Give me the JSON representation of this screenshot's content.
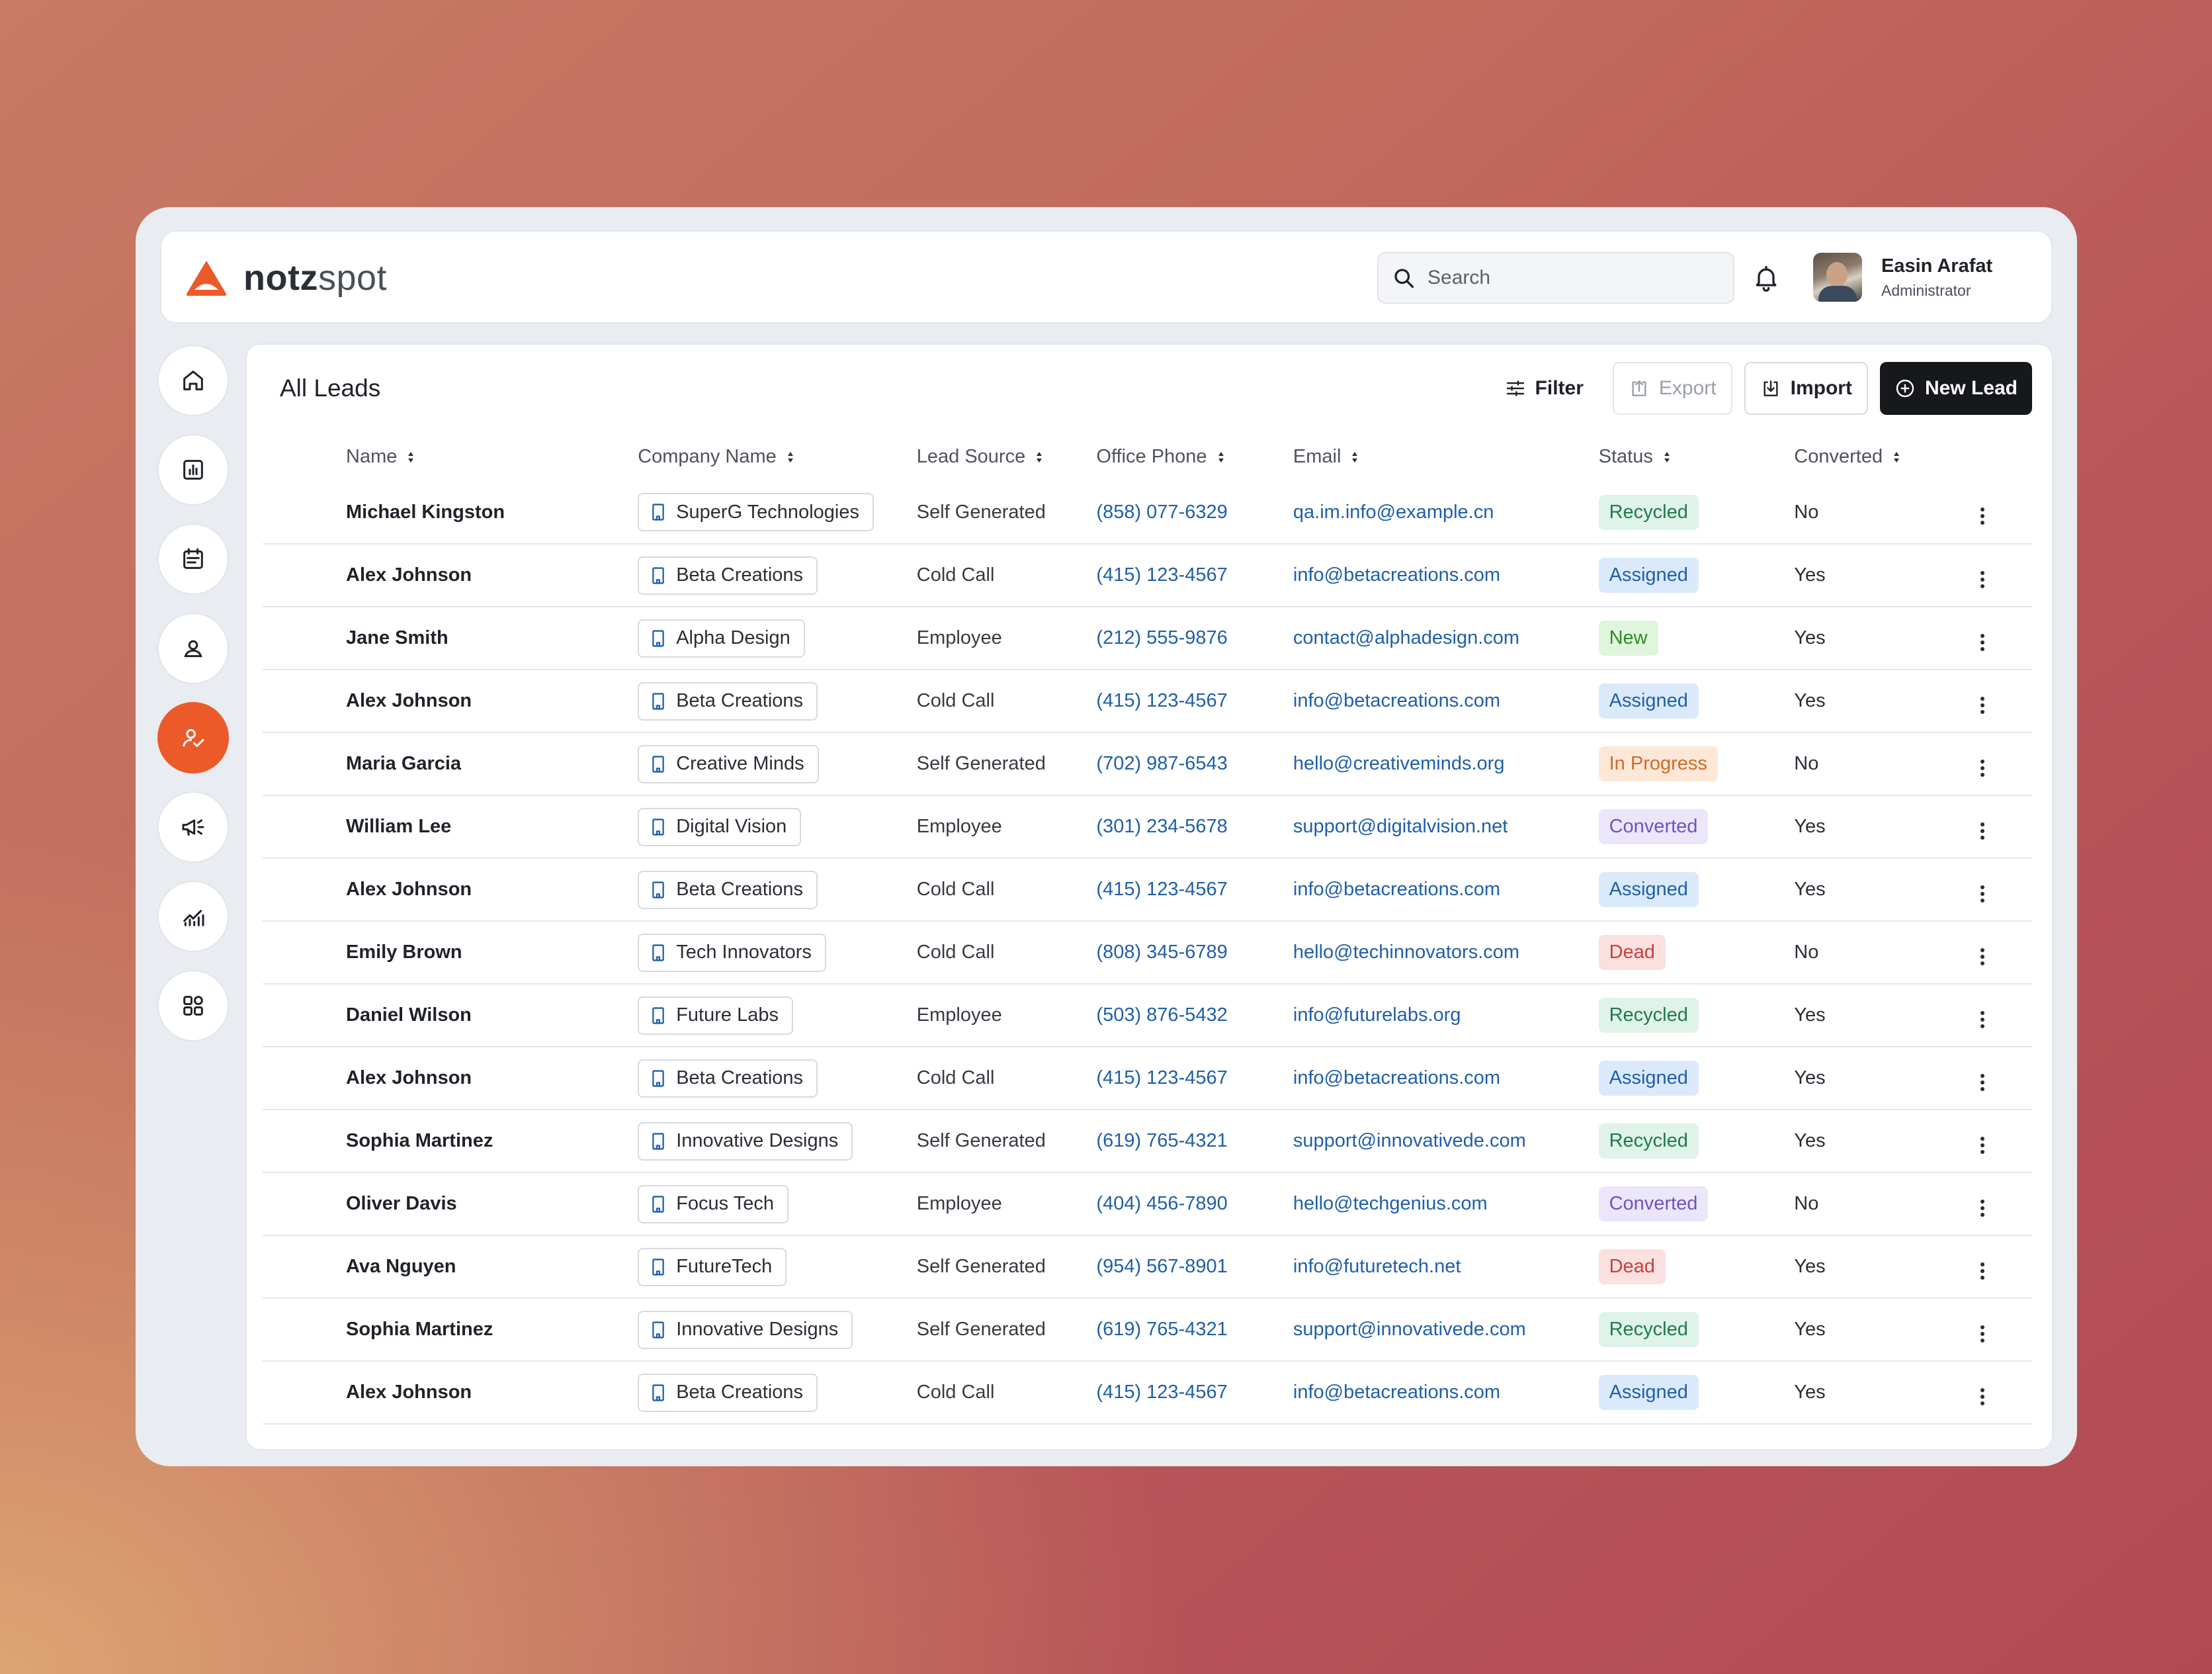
{
  "brand": {
    "name_bold": "notz",
    "name_light": "spot",
    "accent": "#ec5a2a"
  },
  "search": {
    "placeholder": "Search"
  },
  "user": {
    "name": "Easin Arafat",
    "role": "Administrator"
  },
  "nav": {
    "items": [
      {
        "icon": "home-icon"
      },
      {
        "icon": "bar-chart-icon"
      },
      {
        "icon": "calendar-icon"
      },
      {
        "icon": "user-icon"
      },
      {
        "icon": "user-check-icon",
        "active": true
      },
      {
        "icon": "megaphone-icon"
      },
      {
        "icon": "line-chart-icon"
      },
      {
        "icon": "apps-grid-icon"
      }
    ]
  },
  "page": {
    "title": "All Leads"
  },
  "toolbar": {
    "filter_label": "Filter",
    "export_label": "Export",
    "import_label": "Import",
    "new_label": "New Lead"
  },
  "table": {
    "columns": [
      "Name",
      "Company Name",
      "Lead Source",
      "Office Phone",
      "Email",
      "Status",
      "Converted"
    ],
    "rows": [
      {
        "name": "Michael Kingston",
        "company": "SuperG Technologies",
        "source": "Self Generated",
        "phone": "(858) 077-6329",
        "email": "qa.im.info@example.cn",
        "status": "Recycled",
        "converted": "No"
      },
      {
        "name": "Alex Johnson",
        "company": "Beta Creations",
        "source": "Cold Call",
        "phone": "(415) 123-4567",
        "email": "info@betacreations.com",
        "status": "Assigned",
        "converted": "Yes"
      },
      {
        "name": "Jane Smith",
        "company": "Alpha Design",
        "source": "Employee",
        "phone": "(212) 555-9876",
        "email": "contact@alphadesign.com",
        "status": "New",
        "converted": "Yes"
      },
      {
        "name": "Alex Johnson",
        "company": "Beta Creations",
        "source": "Cold Call",
        "phone": "(415) 123-4567",
        "email": "info@betacreations.com",
        "status": "Assigned",
        "converted": "Yes"
      },
      {
        "name": "Maria Garcia",
        "company": "Creative Minds",
        "source": "Self Generated",
        "phone": "(702) 987-6543",
        "email": "hello@creativeminds.org",
        "status": "In Progress",
        "converted": "No"
      },
      {
        "name": "William Lee",
        "company": "Digital Vision",
        "source": "Employee",
        "phone": "(301) 234-5678",
        "email": "support@digitalvision.net",
        "status": "Converted",
        "converted": "Yes"
      },
      {
        "name": "Alex Johnson",
        "company": "Beta Creations",
        "source": "Cold Call",
        "phone": "(415) 123-4567",
        "email": "info@betacreations.com",
        "status": "Assigned",
        "converted": "Yes"
      },
      {
        "name": "Emily Brown",
        "company": "Tech Innovators",
        "source": "Cold Call",
        "phone": "(808) 345-6789",
        "email": "hello@techinnovators.com",
        "status": "Dead",
        "converted": "No"
      },
      {
        "name": "Daniel Wilson",
        "company": "Future Labs",
        "source": "Employee",
        "phone": "(503) 876-5432",
        "email": "info@futurelabs.org",
        "status": "Recycled",
        "converted": "Yes"
      },
      {
        "name": "Alex Johnson",
        "company": "Beta Creations",
        "source": "Cold Call",
        "phone": "(415) 123-4567",
        "email": "info@betacreations.com",
        "status": "Assigned",
        "converted": "Yes"
      },
      {
        "name": "Sophia Martinez",
        "company": "Innovative Designs",
        "source": "Self Generated",
        "phone": "(619) 765-4321",
        "email": "support@innovativede.com",
        "status": "Recycled",
        "converted": "Yes"
      },
      {
        "name": "Oliver Davis",
        "company": "Focus Tech",
        "source": "Employee",
        "phone": "(404) 456-7890",
        "email": "hello@techgenius.com",
        "status": "Converted",
        "converted": "No"
      },
      {
        "name": "Ava Nguyen",
        "company": "FutureTech",
        "source": "Self Generated",
        "phone": "(954) 567-8901",
        "email": "info@futuretech.net",
        "status": "Dead",
        "converted": "Yes"
      },
      {
        "name": "Sophia Martinez",
        "company": "Innovative Designs",
        "source": "Self Generated",
        "phone": "(619) 765-4321",
        "email": "support@innovativede.com",
        "status": "Recycled",
        "converted": "Yes"
      },
      {
        "name": "Alex Johnson",
        "company": "Beta Creations",
        "source": "Cold Call",
        "phone": "(415) 123-4567",
        "email": "info@betacreations.com",
        "status": "Assigned",
        "converted": "Yes"
      }
    ]
  },
  "status_colors": {
    "Recycled": "#1f7a4c",
    "Assigned": "#1f5fa8",
    "New": "#2f8a2a",
    "In Progress": "#d06a26",
    "Converted": "#7051c2",
    "Dead": "#c8403b"
  }
}
